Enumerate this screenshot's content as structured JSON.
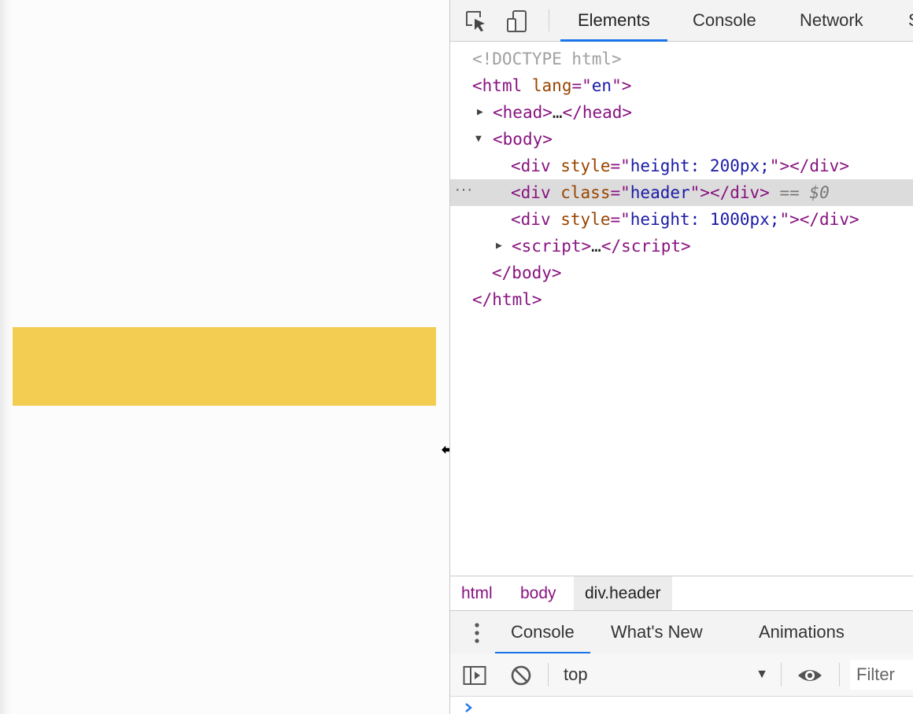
{
  "devtools": {
    "tabs": [
      {
        "label": "Elements",
        "active": true
      },
      {
        "label": "Console",
        "active": false
      },
      {
        "label": "Network",
        "active": false
      },
      {
        "label": "S",
        "active": false
      }
    ],
    "icons": {
      "inspect": "inspect-element-icon",
      "device": "device-toolbar-icon"
    }
  },
  "dom": {
    "doctype": "<!DOCTYPE html>",
    "html_open": {
      "tag": "html",
      "attr": "lang",
      "value": "en"
    },
    "head": {
      "open": "head",
      "ellipsis": "…",
      "close": "head"
    },
    "body_open": "body",
    "div1": {
      "tag": "div",
      "attr": "style",
      "value": "height: 200px;"
    },
    "div2": {
      "tag": "div",
      "attr": "class",
      "value": "header",
      "marker": "==",
      "var": "$0"
    },
    "div3": {
      "tag": "div",
      "attr": "style",
      "value": "height: 1000px;"
    },
    "script": {
      "open": "script",
      "ellipsis": "…",
      "close": "script"
    },
    "body_close": "body",
    "html_close": "html",
    "dots": "···"
  },
  "breadcrumbs": [
    {
      "label": "html",
      "current": false
    },
    {
      "label": "body",
      "current": false
    },
    {
      "label": "div.header",
      "current": true
    }
  ],
  "drawer": {
    "tabs": [
      {
        "label": "Console",
        "active": true
      },
      {
        "label": "What's New",
        "active": false
      },
      {
        "label": "Animations",
        "active": false
      }
    ]
  },
  "console": {
    "context": "top",
    "filter_placeholder": "Filter"
  },
  "colors": {
    "header_box": "#f3cd52",
    "accent": "#1a73e8",
    "tag": "#881280",
    "attr_name": "#994500",
    "attr_value": "#1a1aa6"
  }
}
